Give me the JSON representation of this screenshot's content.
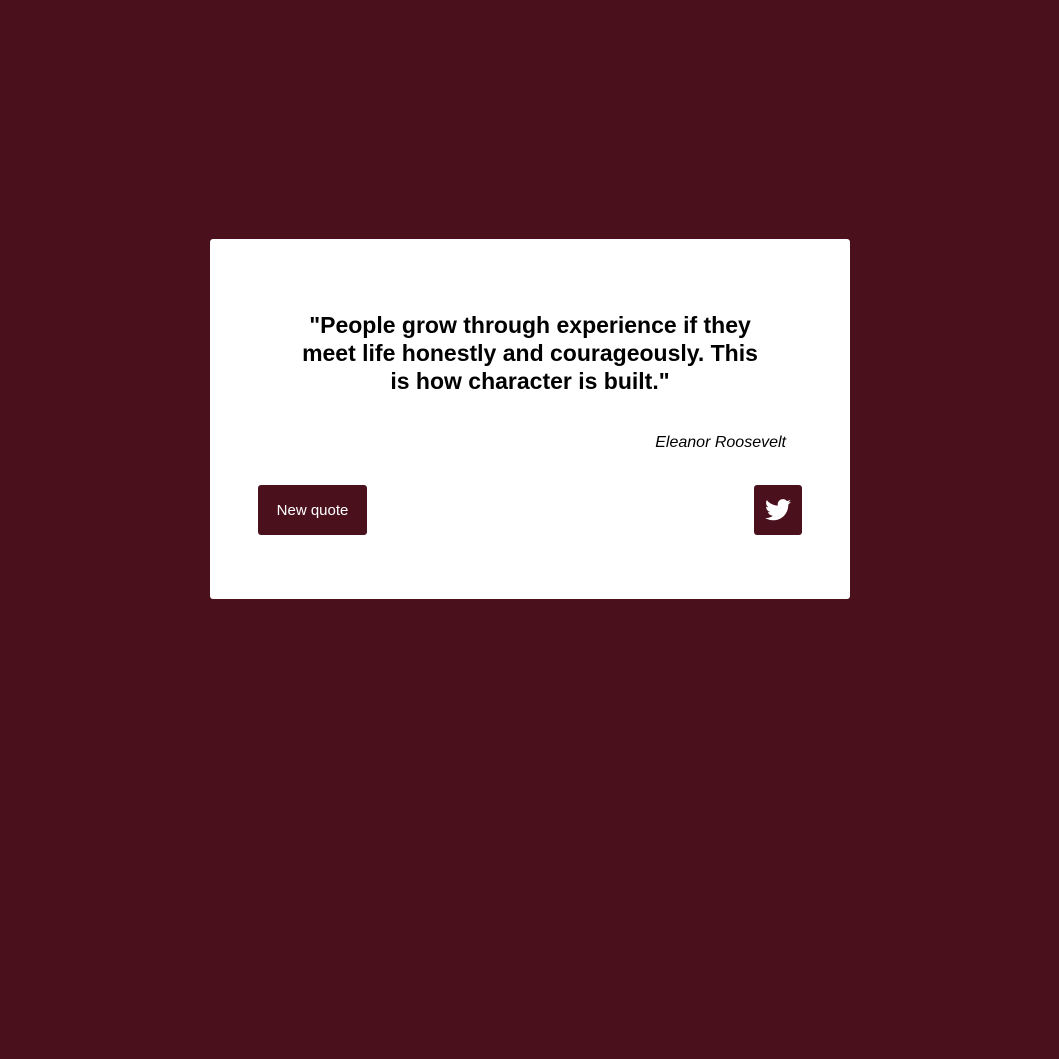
{
  "quote": {
    "text": "\"People grow through experience if they meet life honestly and courageously. This is how character is built.\"",
    "author": "Eleanor Roosevelt"
  },
  "buttons": {
    "new_quote_label": "New quote",
    "tweet_icon": "twitter-icon"
  },
  "colors": {
    "background": "#4a111d",
    "card": "#ffffff",
    "button": "#4a111d",
    "text": "#000000"
  }
}
